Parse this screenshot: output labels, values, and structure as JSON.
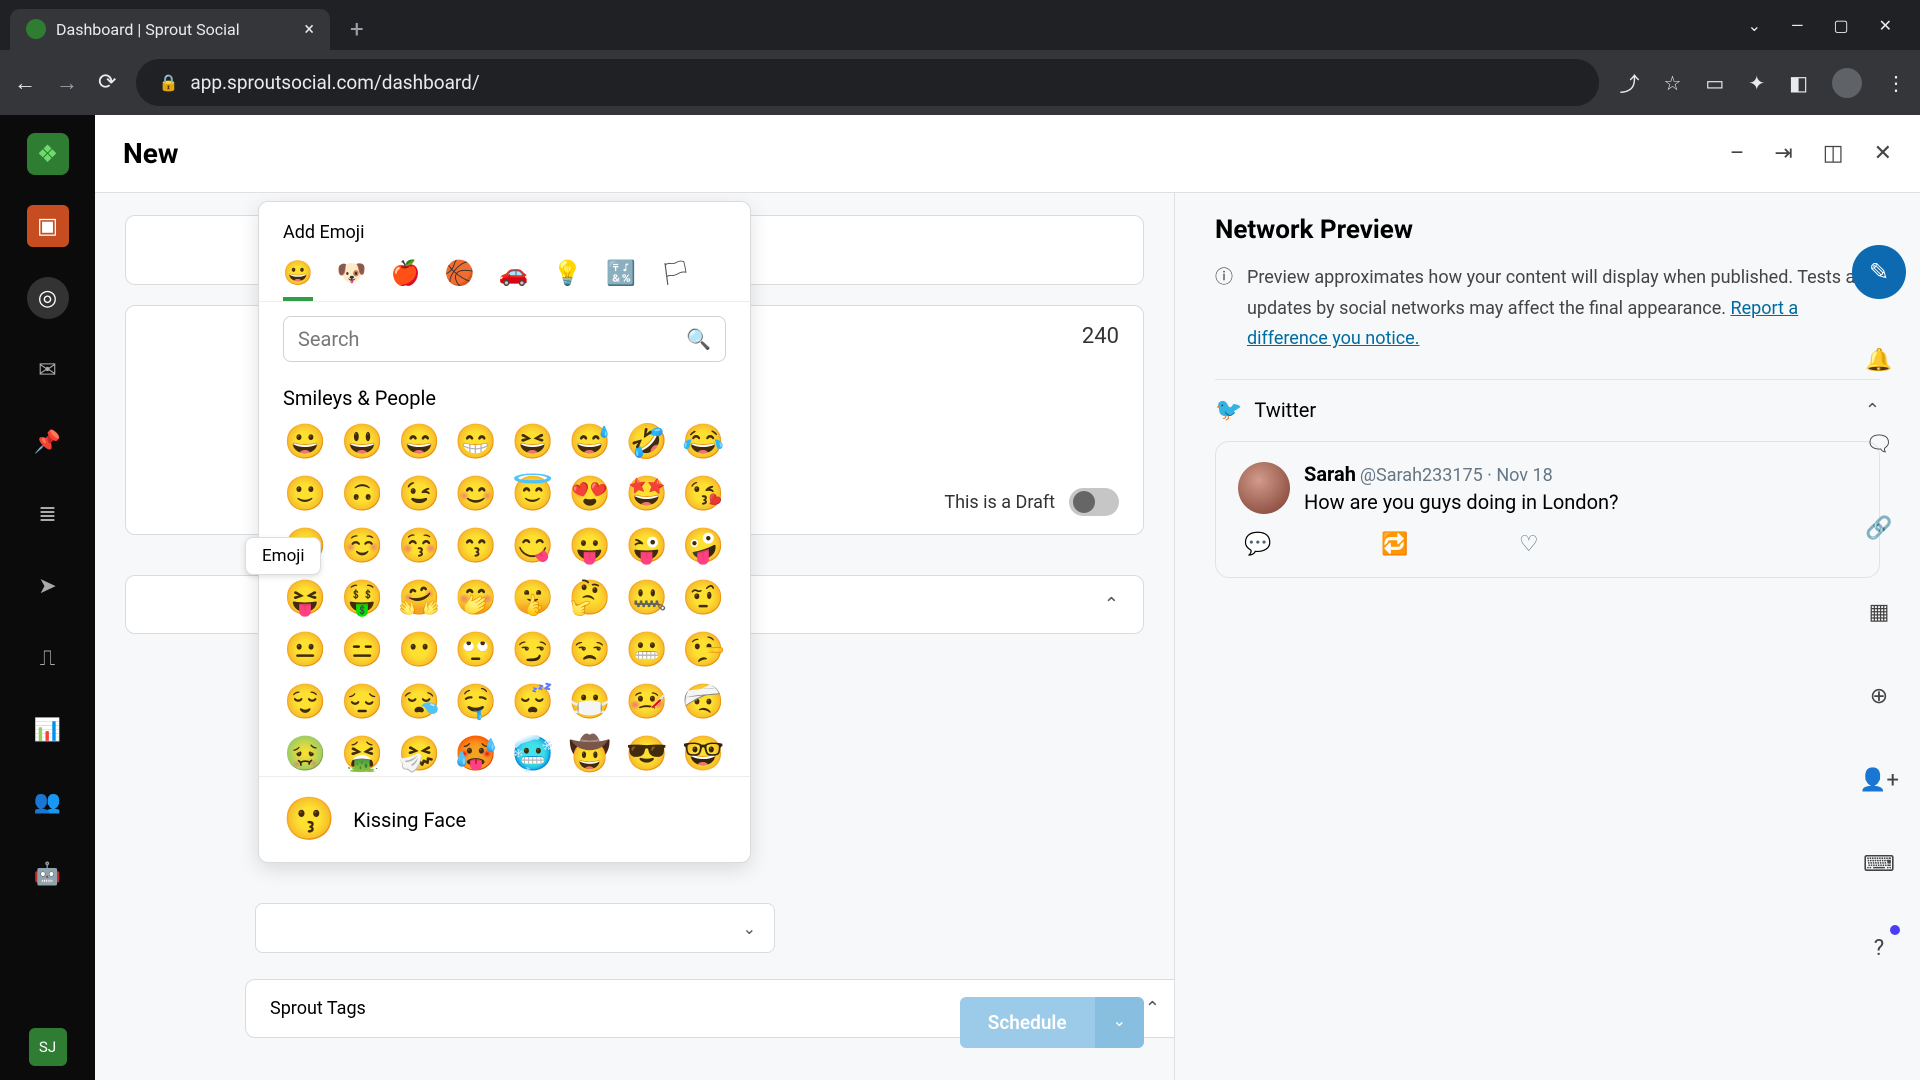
{
  "browser": {
    "tab_title": "Dashboard | Sprout Social",
    "url": "app.sproutsocial.com/dashboard/"
  },
  "composer": {
    "page_title": "New",
    "char_count": "240",
    "draft_label": "This is a Draft",
    "schedule_label": "Schedule",
    "tags_label": "Sprout Tags"
  },
  "emoji_picker": {
    "title": "Add Emoji",
    "search_placeholder": "Search",
    "section_label": "Smileys & People",
    "tooltip_label": "Emoji",
    "hover_name": "Kissing Face",
    "hover_emoji": "😗",
    "categories": [
      "😀",
      "🐶",
      "🍎",
      "🏀",
      "🚗",
      "💡",
      "🔣",
      "🏳"
    ],
    "emojis": [
      "😀",
      "😃",
      "😄",
      "😁",
      "😆",
      "😅",
      "🤣",
      "😂",
      "🙂",
      "🙃",
      "😉",
      "😊",
      "😇",
      "😍",
      "🤩",
      "😘",
      "😗",
      "☺️",
      "😚",
      "😙",
      "😋",
      "😛",
      "😜",
      "🤪",
      "😝",
      "🤑",
      "🤗",
      "🤭",
      "🤫",
      "🤔",
      "🤐",
      "🤨",
      "😐",
      "😑",
      "😶",
      "🙄",
      "😏",
      "😒",
      "😬",
      "🤥",
      "😌",
      "😔",
      "😪",
      "🤤",
      "😴",
      "😷",
      "🤒",
      "🤕",
      "🤢",
      "🤮",
      "🤧",
      "🥵",
      "🥶",
      "🤠",
      "😎",
      "🤓"
    ]
  },
  "preview": {
    "title": "Network Preview",
    "info_text": "Preview approximates how your content will display when published. Tests and updates by social networks may affect the final appearance. ",
    "info_link": "Report a difference you notice.",
    "network_name": "Twitter",
    "tweet": {
      "name": "Sarah",
      "handle": "@Sarah233175",
      "date": "Nov 18",
      "text": "How are you guys doing in London?"
    }
  },
  "left_rail": {
    "user_initials": "SJ"
  }
}
